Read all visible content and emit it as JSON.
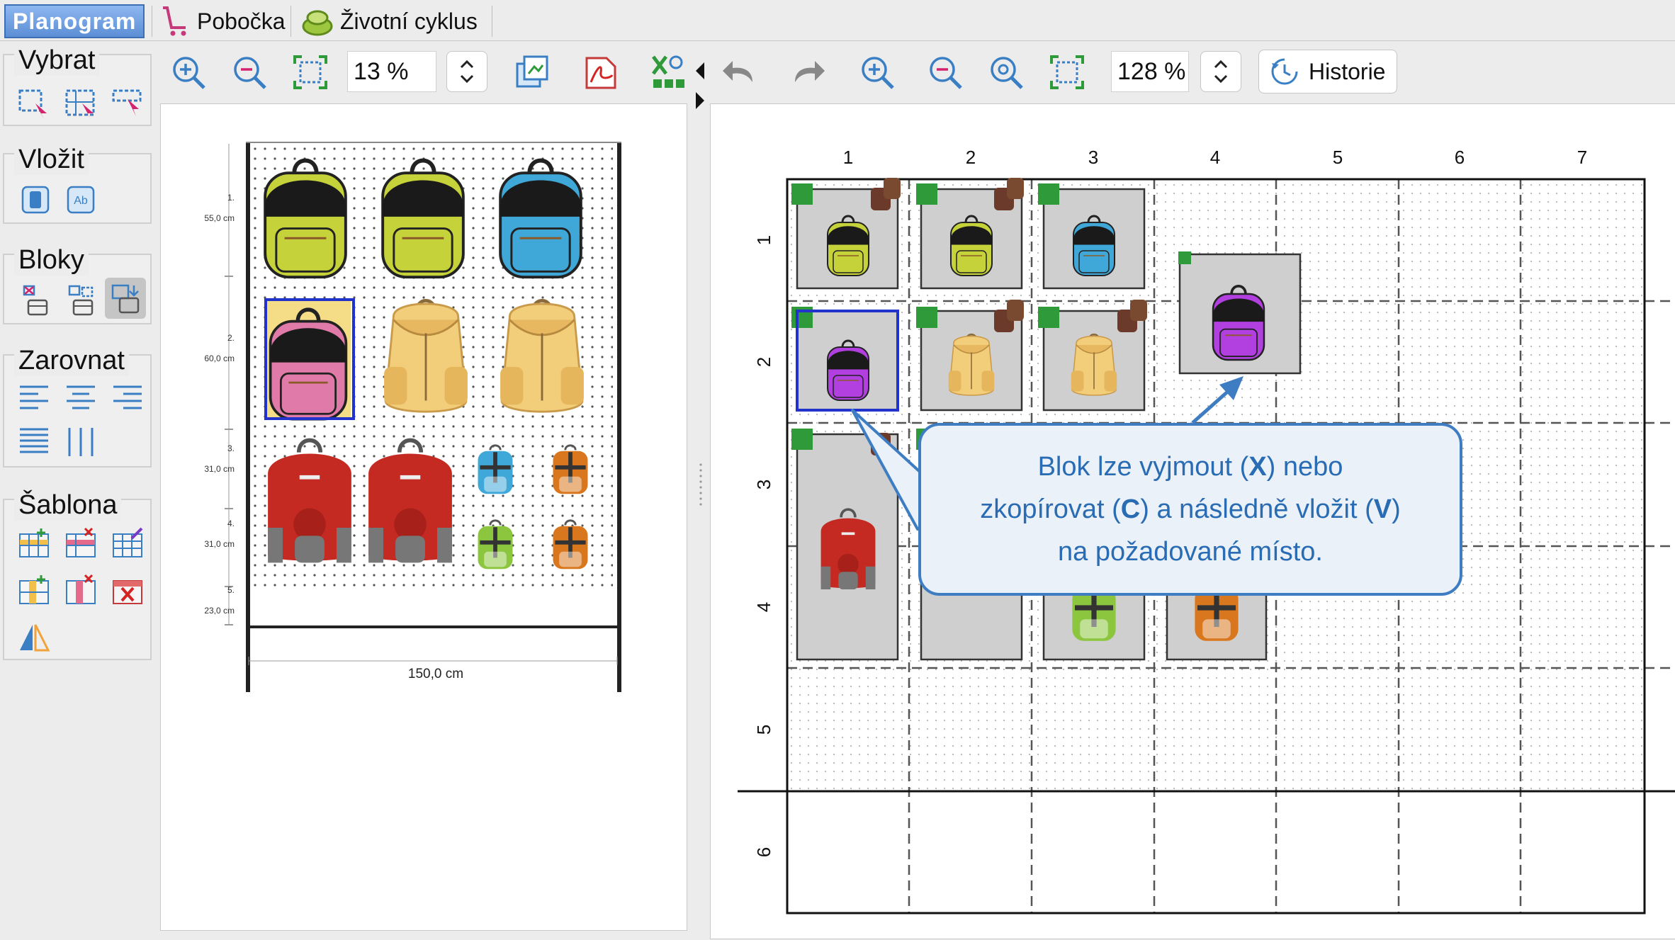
{
  "tabs": [
    {
      "label": "Planogram",
      "icon": "planogram-tab"
    },
    {
      "label": "Pobočka",
      "icon": "shopping-cart-icon"
    },
    {
      "label": "Životní cyklus",
      "icon": "lifecycle-icon"
    }
  ],
  "sidebar": {
    "groups": [
      {
        "title": "Vybrat"
      },
      {
        "title": "Vložit"
      },
      {
        "title": "Bloky"
      },
      {
        "title": "Zarovnat"
      },
      {
        "title": "Šablona"
      }
    ]
  },
  "left_toolbar": {
    "zoom": "13 %"
  },
  "right_toolbar": {
    "zoom": "128 %",
    "history_label": "Historie"
  },
  "preview": {
    "shelves": [
      {
        "num": "1.",
        "height": "55,0 cm"
      },
      {
        "num": "2.",
        "height": "60,0 cm"
      },
      {
        "num": "3.",
        "height": "31,0 cm"
      },
      {
        "num": "4.",
        "height": "31,0 cm"
      },
      {
        "num": "5.",
        "height": "23,0 cm"
      }
    ],
    "width_label": "150,0 cm"
  },
  "grid": {
    "columns": [
      "1",
      "2",
      "3",
      "4",
      "5",
      "6",
      "7"
    ],
    "rows": [
      "1",
      "2",
      "3",
      "4",
      "5",
      "6"
    ]
  },
  "callout": {
    "line1_a": "Blok lze vyjmout (",
    "line1_key": "X",
    "line1_b": ") nebo",
    "line2_a": "zkopírovat (",
    "line2_key1": "C",
    "line2_b": ") a následně vložit (",
    "line2_key2": "V",
    "line2_c": ")",
    "line3": "na požadované místo."
  },
  "colors": {
    "accent": "#3f7dc2",
    "selection": "#2233cc",
    "marker": "#2f9a3a",
    "lime": "#c6d23a",
    "blue": "#3fa8d8",
    "purple": "#b23fe0",
    "pink": "#e07aa8",
    "red": "#c42a22",
    "beige": "#f2cd7a",
    "orange": "#d9771e",
    "green": "#8cc63f"
  }
}
